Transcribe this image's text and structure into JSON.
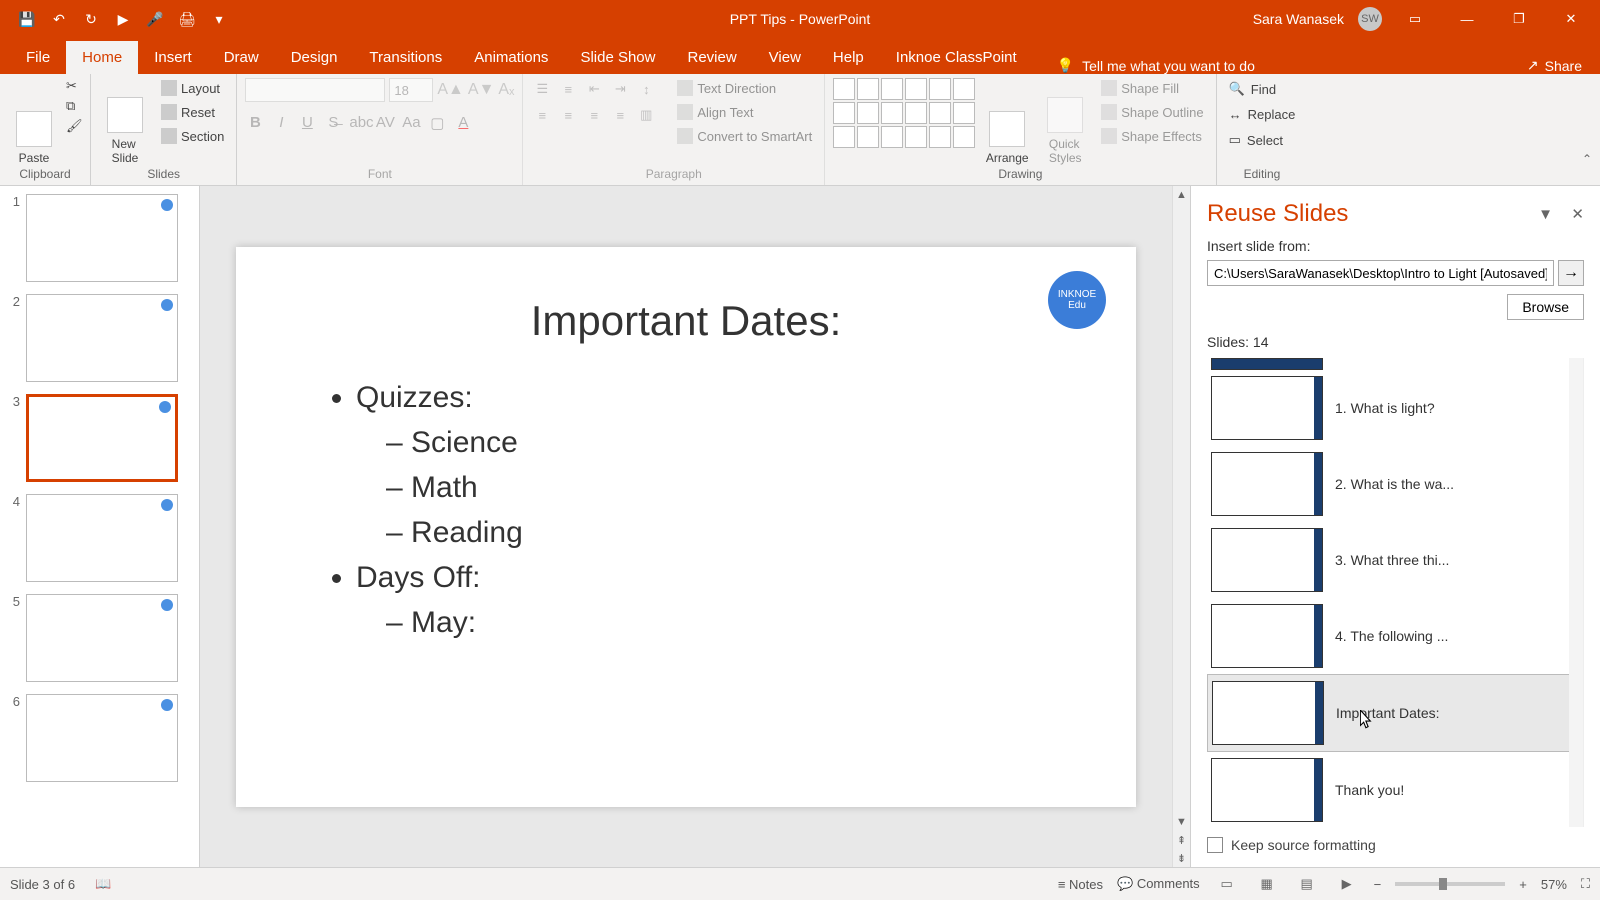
{
  "titlebar": {
    "app_title": "PPT Tips  -  PowerPoint",
    "user_name": "Sara Wanasek",
    "user_initials": "SW"
  },
  "tabs": {
    "file": "File",
    "home": "Home",
    "insert": "Insert",
    "draw": "Draw",
    "design": "Design",
    "transitions": "Transitions",
    "animations": "Animations",
    "slideshow": "Slide Show",
    "review": "Review",
    "view": "View",
    "help": "Help",
    "inknoe": "Inknoe ClassPoint",
    "tellme": "Tell me what you want to do",
    "share": "Share"
  },
  "ribbon": {
    "clipboard": {
      "paste": "Paste",
      "label": "Clipboard"
    },
    "slides": {
      "new_slide": "New\nSlide",
      "layout": "Layout",
      "reset": "Reset",
      "section": "Section",
      "label": "Slides"
    },
    "font": {
      "size": "18",
      "label": "Font"
    },
    "paragraph": {
      "text_direction": "Text Direction",
      "align_text": "Align Text",
      "smartart": "Convert to SmartArt",
      "label": "Paragraph"
    },
    "drawing": {
      "arrange": "Arrange",
      "quick_styles": "Quick\nStyles",
      "shape_fill": "Shape Fill",
      "shape_outline": "Shape Outline",
      "shape_effects": "Shape Effects",
      "label": "Drawing"
    },
    "editing": {
      "find": "Find",
      "replace": "Replace",
      "select": "Select",
      "label": "Editing"
    }
  },
  "slide": {
    "title": "Important Dates:",
    "bullets": {
      "quizzes": "Quizzes:",
      "science": "Science",
      "math": "Math",
      "reading": "Reading",
      "days_off": "Days Off:",
      "may": "May:"
    },
    "badge": "INKNOE\nEdu"
  },
  "thumbnails": [
    "1",
    "2",
    "3",
    "4",
    "5",
    "6"
  ],
  "reuse": {
    "title": "Reuse Slides",
    "insert_from": "Insert slide from:",
    "path": "C:\\Users\\SaraWanasek\\Desktop\\Intro to Light [Autosaved].",
    "browse": "Browse",
    "count": "Slides: 14",
    "items": [
      {
        "label": "1. What is light?"
      },
      {
        "label": "2. What is the wa..."
      },
      {
        "label": "3. What three thi..."
      },
      {
        "label": "4. The following ..."
      },
      {
        "label": "Important Dates:"
      },
      {
        "label": "Thank you!"
      }
    ],
    "keep": "Keep source formatting"
  },
  "status": {
    "slide_info": "Slide 3 of 6",
    "notes": "Notes",
    "comments": "Comments",
    "zoom": "57%"
  }
}
